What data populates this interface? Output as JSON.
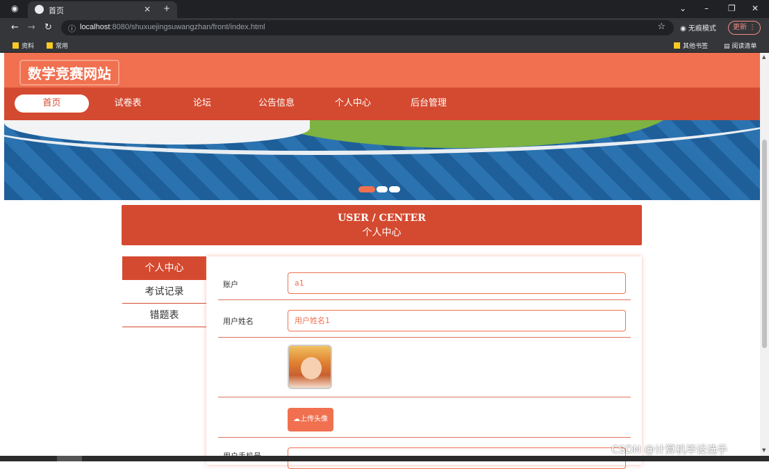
{
  "browser": {
    "tab_title": "首页",
    "tab_close": "×",
    "new_tab": "+",
    "url_host": "localhost",
    "url_rest": ":8080/shuxuejingsuwangzhan/front/index.html",
    "incognito_label": "无痕模式",
    "update_label": "更新 ⋮",
    "bookmarks": [
      "资料",
      "常用"
    ],
    "bookmarks_right": [
      "其他书签",
      "阅读清单"
    ]
  },
  "site": {
    "logo": "数学竞赛网站",
    "nav": [
      "首页",
      "试卷表",
      "论坛",
      "公告信息",
      "个人中心",
      "后台管理"
    ]
  },
  "user_center": {
    "title_en": "USER / CENTER",
    "title_zh": "个人中心"
  },
  "side_menu": [
    "个人中心",
    "考试记录",
    "错题表"
  ],
  "form": {
    "account_label": "账户",
    "account_value": "a1",
    "name_label": "用户姓名",
    "name_value": "用户姓名1",
    "upload_label": "上传头像",
    "next_label_partial": "用户手机号"
  },
  "watermark": "CSDN @计算机毕设选手",
  "colors": {
    "header": "#f07050",
    "nav": "#d44a30",
    "accent": "#f07050"
  },
  "icons": [
    "chrome-favicon",
    "back-arrow-icon",
    "forward-arrow-icon",
    "reload-icon",
    "info-icon",
    "star-icon",
    "incognito-icon",
    "folder-icon",
    "reading-list-icon",
    "cloud-upload-icon"
  ]
}
